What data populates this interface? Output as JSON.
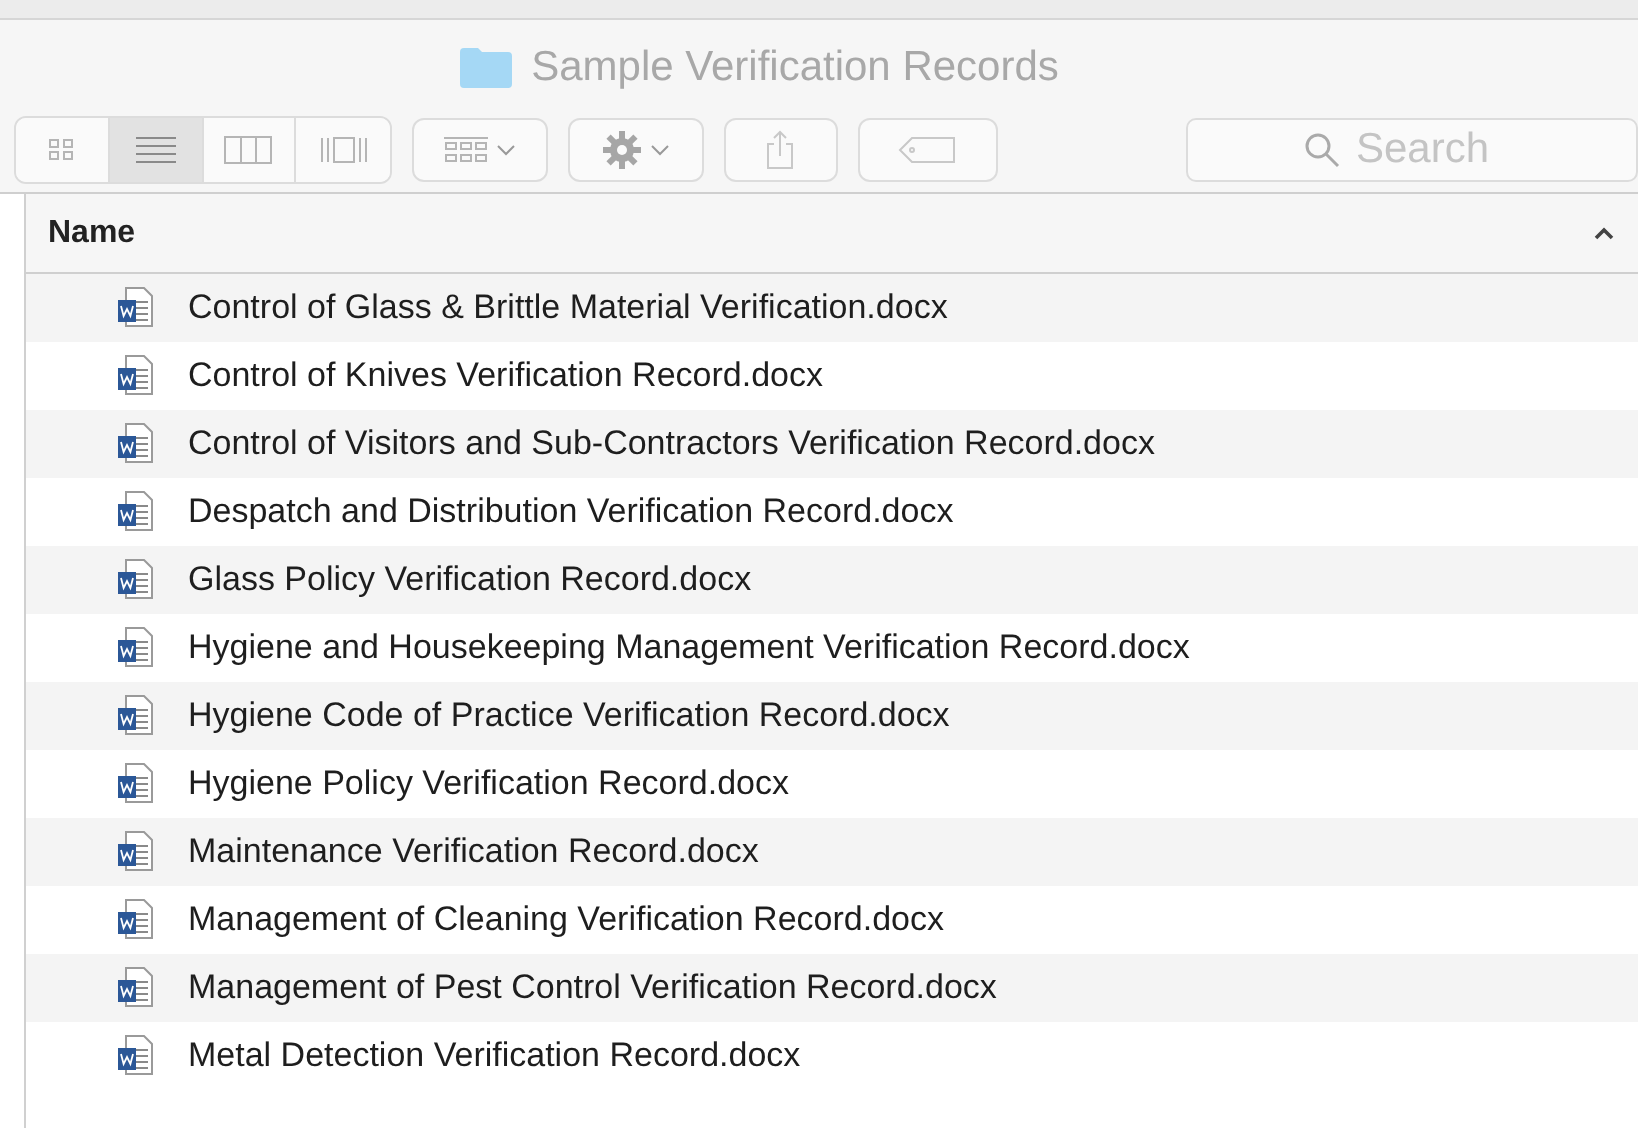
{
  "window": {
    "title": "Sample Verification Records"
  },
  "toolbar": {
    "view_modes": [
      {
        "kind": "icons",
        "selected": false
      },
      {
        "kind": "list",
        "selected": true
      },
      {
        "kind": "columns",
        "selected": false
      },
      {
        "kind": "gallery",
        "selected": false
      }
    ],
    "search": {
      "placeholder": "Search"
    }
  },
  "table": {
    "columns": [
      {
        "label": "Name",
        "sorted_ascending": true
      }
    ],
    "rows": [
      {
        "name": "Control of Glass & Brittle Material Verification.docx"
      },
      {
        "name": "Control of Knives Verification Record.docx"
      },
      {
        "name": "Control of Visitors and Sub-Contractors Verification Record.docx"
      },
      {
        "name": "Despatch and Distribution Verification Record.docx"
      },
      {
        "name": "Glass Policy Verification Record.docx"
      },
      {
        "name": "Hygiene and Housekeeping Management Verification Record.docx"
      },
      {
        "name": "Hygiene Code of Practice Verification Record.docx"
      },
      {
        "name": "Hygiene Policy Verification Record.docx"
      },
      {
        "name": "Maintenance Verification Record.docx"
      },
      {
        "name": "Management of Cleaning Verification Record.docx"
      },
      {
        "name": "Management of Pest Control Verification Record.docx"
      },
      {
        "name": "Metal Detection Verification Record.docx"
      }
    ]
  }
}
